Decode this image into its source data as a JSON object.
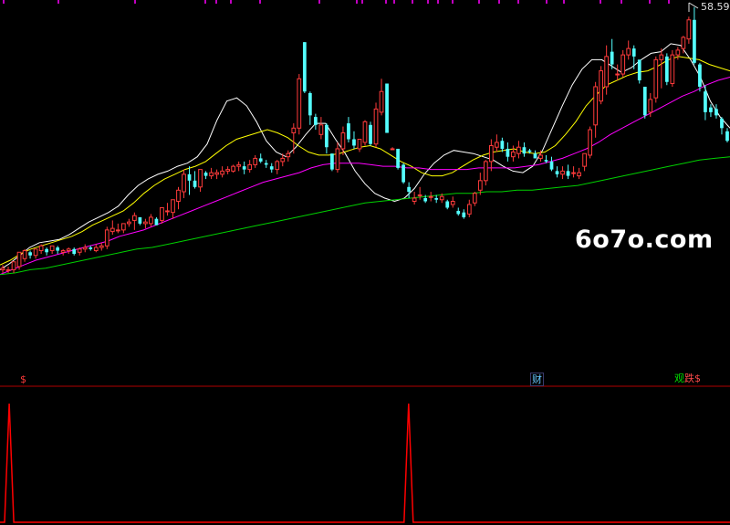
{
  "watermark": "6o7o.com",
  "price_label": "58.59",
  "markers": {
    "s_left": "$",
    "cai": "财",
    "multi_a": "观",
    "multi_b": "跌",
    "multi_c": "$"
  },
  "colors": {
    "background": "#000000",
    "candle_up": "#ff3b3b",
    "candle_down": "#54ffff",
    "ma5": "#ffffff",
    "ma10": "#ffff00",
    "ma20": "#ff00ff",
    "ma60": "#00d000",
    "divider": "#b00000",
    "indicator": "#ff0000"
  },
  "chart_data": {
    "type": "candlestick",
    "title": "",
    "xlabel": "",
    "ylabel": "",
    "ylim": [
      40.29,
      58.59
    ],
    "candles": [
      [
        42.1,
        42.4,
        42.2,
        41.9
      ],
      [
        42.1,
        42.3,
        42.1,
        41.9
      ],
      [
        42.1,
        42.6,
        42.6,
        41.9
      ],
      [
        42.3,
        43.2,
        43.2,
        42.1
      ],
      [
        42.8,
        43.4,
        43.3,
        42.6
      ],
      [
        43.2,
        43.3,
        43.0,
        42.8
      ],
      [
        43.0,
        43.4,
        43.4,
        42.8
      ],
      [
        43.3,
        43.7,
        43.6,
        43.1
      ],
      [
        43.4,
        43.5,
        43.2,
        43.0
      ],
      [
        43.3,
        43.6,
        43.6,
        43.1
      ],
      [
        43.5,
        43.6,
        43.3,
        43.1
      ],
      [
        43.2,
        43.4,
        43.3,
        43.0
      ],
      [
        43.3,
        43.5,
        43.4,
        43.1
      ],
      [
        43.4,
        43.5,
        43.1,
        43.0
      ],
      [
        43.2,
        43.5,
        43.4,
        43.0
      ],
      [
        43.4,
        43.7,
        43.5,
        43.2
      ],
      [
        43.5,
        43.6,
        43.4,
        43.3
      ],
      [
        43.3,
        43.7,
        43.5,
        43.2
      ],
      [
        43.5,
        43.8,
        43.6,
        43.3
      ],
      [
        43.6,
        44.8,
        44.6,
        43.4
      ],
      [
        44.5,
        45.2,
        44.7,
        44.3
      ],
      [
        44.6,
        45.0,
        44.6,
        44.4
      ],
      [
        44.6,
        45.0,
        45.0,
        44.4
      ],
      [
        45.0,
        45.3,
        45.1,
        44.8
      ],
      [
        45.2,
        45.7,
        45.5,
        44.6
      ],
      [
        45.4,
        45.4,
        45.0,
        44.9
      ],
      [
        45.0,
        45.3,
        45.1,
        44.7
      ],
      [
        45.0,
        45.6,
        45.4,
        44.8
      ],
      [
        45.3,
        45.4,
        44.9,
        44.9
      ],
      [
        45.2,
        46.0,
        46.0,
        45.0
      ],
      [
        45.8,
        46.3,
        45.8,
        45.5
      ],
      [
        45.7,
        46.5,
        46.5,
        45.3
      ],
      [
        46.4,
        47.3,
        47.1,
        45.9
      ],
      [
        47.0,
        48.4,
        48.1,
        46.6
      ],
      [
        48.1,
        48.6,
        47.7,
        46.8
      ],
      [
        47.7,
        48.3,
        47.3,
        47.2
      ],
      [
        47.3,
        48.4,
        48.4,
        47.0
      ],
      [
        48.2,
        48.3,
        48.0,
        47.8
      ],
      [
        48.0,
        48.5,
        48.2,
        47.8
      ],
      [
        48.1,
        48.4,
        48.2,
        47.8
      ],
      [
        48.1,
        48.6,
        48.3,
        47.9
      ],
      [
        48.3,
        48.6,
        48.4,
        48.1
      ],
      [
        48.3,
        48.7,
        48.6,
        48.2
      ],
      [
        48.6,
        48.9,
        48.7,
        48.3
      ],
      [
        48.6,
        48.9,
        48.4,
        48.1
      ],
      [
        48.4,
        49.0,
        48.7,
        48.2
      ],
      [
        48.7,
        49.3,
        49.1,
        48.5
      ],
      [
        49.1,
        49.4,
        48.9,
        48.8
      ],
      [
        48.8,
        49.0,
        48.7,
        48.5
      ],
      [
        48.6,
        48.8,
        48.4,
        48.2
      ],
      [
        48.4,
        49.0,
        48.9,
        48.1
      ],
      [
        48.9,
        49.4,
        49.1,
        48.6
      ],
      [
        49.2,
        49.6,
        49.4,
        48.9
      ],
      [
        50.7,
        51.3,
        51.0,
        49.4
      ],
      [
        51.0,
        54.4,
        54.1,
        50.6
      ],
      [
        56.4,
        56.4,
        53.3,
        53.2
      ],
      [
        53.2,
        53.3,
        51.8,
        51.2
      ],
      [
        51.7,
        51.9,
        51.2,
        50.9
      ],
      [
        50.6,
        51.7,
        51.2,
        50.3
      ],
      [
        51.2,
        51.3,
        49.8,
        49.4
      ],
      [
        49.4,
        49.4,
        48.4,
        48.3
      ],
      [
        48.4,
        50.1,
        49.7,
        48.2
      ],
      [
        49.7,
        51.1,
        50.7,
        49.3
      ],
      [
        51.3,
        51.7,
        50.3,
        50.1
      ],
      [
        50.3,
        50.8,
        49.9,
        49.7
      ],
      [
        49.7,
        50.3,
        50.3,
        49.5
      ],
      [
        50.1,
        51.5,
        51.4,
        49.9
      ],
      [
        51.2,
        51.4,
        50.0,
        49.9
      ],
      [
        50.0,
        52.6,
        52.2,
        49.8
      ],
      [
        52.0,
        54.1,
        53.3,
        51.8
      ],
      [
        53.8,
        53.8,
        50.7,
        50.7
      ],
      [
        49.7,
        49.8,
        49.7,
        49.7
      ],
      [
        49.7,
        49.7,
        48.5,
        48.4
      ],
      [
        48.7,
        48.8,
        47.6,
        47.5
      ],
      [
        47.3,
        47.6,
        47.0,
        46.6
      ],
      [
        46.4,
        47.0,
        46.6,
        46.2
      ],
      [
        46.8,
        47.3,
        46.8,
        46.5
      ],
      [
        46.6,
        46.8,
        46.4,
        46.3
      ],
      [
        46.7,
        47.0,
        46.7,
        46.4
      ],
      [
        46.6,
        46.8,
        46.5,
        46.3
      ],
      [
        46.5,
        46.9,
        46.7,
        46.3
      ],
      [
        46.4,
        46.5,
        46.0,
        45.9
      ],
      [
        46.2,
        46.7,
        46.4,
        46.0
      ],
      [
        45.8,
        46.0,
        45.6,
        45.5
      ],
      [
        45.7,
        45.9,
        45.4,
        45.3
      ],
      [
        45.6,
        46.5,
        46.2,
        45.4
      ],
      [
        46.3,
        47.0,
        46.9,
        46.1
      ],
      [
        47.1,
        48.2,
        47.7,
        46.8
      ],
      [
        47.7,
        49.0,
        48.9,
        47.4
      ],
      [
        48.9,
        50.3,
        49.9,
        48.3
      ],
      [
        49.8,
        50.6,
        50.1,
        49.5
      ],
      [
        50.2,
        50.4,
        49.7,
        49.5
      ],
      [
        49.7,
        50.1,
        49.2,
        48.9
      ],
      [
        49.2,
        49.9,
        49.5,
        48.9
      ],
      [
        49.4,
        50.2,
        49.8,
        49.1
      ],
      [
        49.8,
        50.1,
        49.4,
        49.2
      ],
      [
        49.6,
        49.7,
        49.5,
        49.4
      ],
      [
        49.4,
        49.6,
        49.1,
        49.1
      ],
      [
        49.1,
        49.6,
        49.3,
        48.9
      ],
      [
        49.0,
        49.3,
        48.9,
        48.8
      ],
      [
        48.9,
        49.2,
        48.4,
        48.3
      ],
      [
        48.3,
        48.6,
        48.1,
        47.9
      ],
      [
        48.1,
        48.6,
        48.3,
        47.8
      ],
      [
        48.3,
        48.7,
        48.0,
        47.8
      ],
      [
        48.2,
        48.6,
        48.2,
        47.9
      ],
      [
        48.0,
        48.5,
        48.2,
        47.8
      ],
      [
        48.6,
        49.4,
        49.4,
        48.3
      ],
      [
        49.3,
        51.1,
        50.9,
        49.1
      ],
      [
        51.2,
        53.9,
        53.6,
        50.4
      ],
      [
        52.7,
        54.9,
        54.6,
        52.5
      ],
      [
        53.6,
        56.2,
        55.5,
        53.1
      ],
      [
        55.8,
        56.6,
        55.0,
        54.7
      ],
      [
        54.4,
        55.0,
        54.4,
        54.0
      ],
      [
        54.4,
        55.9,
        55.6,
        54.2
      ],
      [
        55.6,
        56.5,
        56.0,
        55.3
      ],
      [
        56.0,
        56.2,
        55.5,
        54.7
      ],
      [
        55.3,
        55.3,
        54.0,
        53.8
      ],
      [
        53.6,
        53.6,
        51.8,
        51.6
      ],
      [
        52.0,
        53.2,
        52.8,
        51.7
      ],
      [
        52.9,
        55.5,
        55.3,
        52.6
      ],
      [
        55.3,
        56.0,
        55.6,
        53.5
      ],
      [
        55.5,
        55.7,
        53.9,
        53.7
      ],
      [
        53.8,
        55.9,
        55.6,
        53.6
      ],
      [
        55.6,
        56.1,
        55.9,
        55.3
      ],
      [
        56.0,
        56.8,
        56.7,
        55.7
      ],
      [
        56.6,
        58.0,
        57.8,
        56.3
      ],
      [
        57.8,
        58.6,
        55.1,
        55.0
      ],
      [
        55.0,
        55.1,
        53.6,
        53.3
      ],
      [
        53.3,
        53.7,
        52.0,
        51.5
      ],
      [
        52.3,
        52.5,
        52.0,
        51.7
      ],
      [
        52.2,
        52.5,
        51.8,
        51.6
      ],
      [
        51.6,
        51.7,
        51.0,
        50.6
      ],
      [
        50.8,
        51.0,
        50.2,
        50.1
      ]
    ],
    "ma_series": [
      {
        "values": [
          42.1,
          42.5,
          43.0,
          43.5,
          43.8,
          43.9,
          44.0,
          44.3,
          44.7,
          45.1,
          45.4,
          45.7,
          46.1,
          46.8,
          47.4,
          47.8,
          48.1,
          48.3,
          48.6,
          48.8,
          49.2,
          50.0,
          51.5,
          52.7,
          52.9,
          52.4,
          51.4,
          50.2,
          49.5,
          49.2,
          49.8,
          50.6,
          51.3,
          51.3,
          50.3,
          49.4,
          48.3,
          47.5,
          46.9,
          46.6,
          46.4,
          46.6,
          47.2,
          48.1,
          48.8,
          49.3,
          49.6,
          49.5,
          49.4,
          49.2,
          49.0,
          48.6,
          48.3,
          48.2,
          48.6,
          49.6,
          51.0,
          52.4,
          53.7,
          54.7,
          55.3,
          55.3,
          54.9,
          54.5,
          54.8,
          55.3,
          55.7,
          55.8,
          56.3,
          56.2,
          55.3,
          54.2,
          52.7,
          51.7,
          51.0
        ]
      },
      {
        "values": [
          42.4,
          42.7,
          43.1,
          43.4,
          43.6,
          43.8,
          44.0,
          44.2,
          44.5,
          44.9,
          45.2,
          45.5,
          45.8,
          46.3,
          46.9,
          47.4,
          47.8,
          48.1,
          48.4,
          48.6,
          48.9,
          49.4,
          49.9,
          50.3,
          50.5,
          50.7,
          50.9,
          50.7,
          50.4,
          49.9,
          49.5,
          49.3,
          49.3,
          49.4,
          49.6,
          49.8,
          49.9,
          49.7,
          49.3,
          48.9,
          48.6,
          48.2,
          48.0,
          48.0,
          48.2,
          48.6,
          49.0,
          49.3,
          49.5,
          49.6,
          49.7,
          49.5,
          49.4,
          49.5,
          49.9,
          50.6,
          51.4,
          52.4,
          53.1,
          53.7,
          54.0,
          54.3,
          54.5,
          54.6,
          54.9,
          55.3,
          55.5,
          55.4,
          55.3,
          55.0,
          54.8,
          54.6
        ]
      },
      {
        "values": [
          41.8,
          42.1,
          42.4,
          42.7,
          42.9,
          43.1,
          43.3,
          43.5,
          43.7,
          43.9,
          44.2,
          44.4,
          44.6,
          44.9,
          45.2,
          45.5,
          45.8,
          46.1,
          46.4,
          46.7,
          47.0,
          47.3,
          47.6,
          47.8,
          48.0,
          48.2,
          48.5,
          48.7,
          48.8,
          48.8,
          48.8,
          48.7,
          48.6,
          48.6,
          48.5,
          48.5,
          48.4,
          48.4,
          48.4,
          48.4,
          48.5,
          48.5,
          48.5,
          48.5,
          48.6,
          48.7,
          48.9,
          49.1,
          49.4,
          49.7,
          50.1,
          50.6,
          51.0,
          51.4,
          51.8,
          52.2,
          52.6,
          53.0,
          53.3,
          53.7,
          54.0,
          54.2
        ]
      },
      {
        "values": [
          41.8,
          41.9,
          42.1,
          42.2,
          42.4,
          42.6,
          42.8,
          43.0,
          43.2,
          43.4,
          43.5,
          43.7,
          43.9,
          44.1,
          44.3,
          44.5,
          44.7,
          44.9,
          45.1,
          45.3,
          45.5,
          45.7,
          45.9,
          46.1,
          46.3,
          46.4,
          46.5,
          46.6,
          46.7,
          46.8,
          46.9,
          46.9,
          47.0,
          47.0,
          47.1,
          47.1,
          47.2,
          47.3,
          47.4,
          47.6,
          47.8,
          48.0,
          48.2,
          48.4,
          48.6,
          48.8,
          49.0,
          49.1,
          49.2
        ]
      }
    ],
    "indicator": {
      "values": [
        0,
        0,
        1,
        0,
        0,
        0,
        0,
        0,
        0,
        0,
        0,
        0,
        0,
        0,
        0,
        0,
        0,
        0,
        0,
        0,
        0,
        0,
        0,
        0,
        0,
        0,
        0,
        0,
        0,
        0,
        0,
        0,
        0,
        0,
        0,
        0,
        0,
        0,
        0,
        0,
        0,
        0,
        0,
        0,
        0,
        0,
        0,
        0,
        0,
        0,
        0,
        0,
        0,
        0,
        0,
        0,
        0,
        0,
        0,
        0,
        0,
        0,
        0,
        0,
        0,
        0,
        0,
        0,
        0,
        0,
        0,
        0,
        0,
        0,
        0,
        0,
        0,
        0,
        0,
        0,
        0,
        0,
        0,
        0,
        0,
        0,
        0,
        0,
        0,
        1,
        0,
        0,
        0,
        0,
        0,
        0,
        0,
        0,
        0,
        0,
        0,
        0,
        0,
        0,
        0,
        0,
        0,
        0,
        0,
        0,
        0,
        0,
        0,
        0,
        0,
        0,
        0,
        0,
        0,
        0,
        0,
        0,
        0,
        0,
        0,
        0,
        0,
        0,
        0,
        0,
        0,
        0,
        0,
        0,
        0,
        0,
        0,
        0,
        0,
        0,
        0,
        0,
        0,
        0,
        0,
        0,
        0,
        0,
        0,
        0,
        0,
        0,
        0,
        0,
        0,
        0,
        0,
        0,
        0,
        0
      ]
    }
  }
}
